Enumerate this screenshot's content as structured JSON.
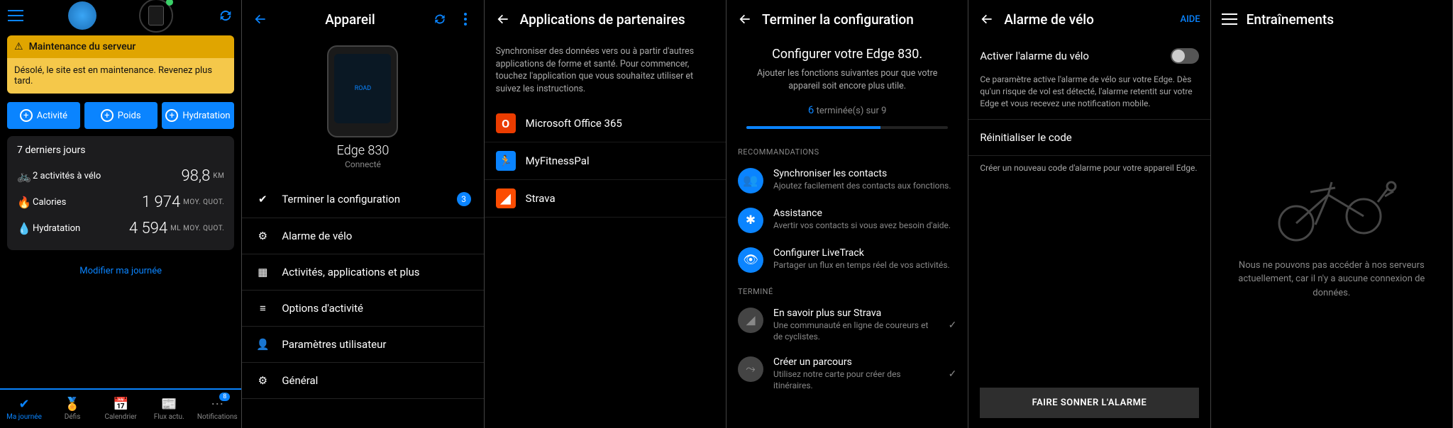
{
  "s1": {
    "maintenance_title": "Maintenance du serveur",
    "maintenance_body": "Désolé, le site est en maintenance. Revenez plus tard.",
    "quick": {
      "activity": "Activité",
      "weight": "Poids",
      "hydration": "Hydratation"
    },
    "card_title": "7 derniers jours",
    "stats": {
      "rides_label": "2 activités à vélo",
      "rides_val": "98,8",
      "rides_unit": "KM",
      "cal_label": "Calories",
      "cal_val": "1 974",
      "cal_unit": "MOY. QUOT.",
      "hyd_label": "Hydratation",
      "hyd_val": "4 594",
      "hyd_unit": "ML MOY. QUOT."
    },
    "edit_link": "Modifier ma journée",
    "nav": {
      "myday": "Ma journée",
      "challenges": "Défis",
      "calendar": "Calendrier",
      "newsfeed": "Flux actu.",
      "notifications": "Notifications",
      "badge": "8"
    }
  },
  "s2": {
    "title": "Appareil",
    "device_name": "Edge 830",
    "device_status": "Connecté",
    "items": {
      "finish": "Terminer la configuration",
      "finish_badge": "3",
      "alarm": "Alarme de vélo",
      "apps": "Activités, applications et plus",
      "options": "Options d'activité",
      "user": "Paramètres utilisateur",
      "general": "Général"
    }
  },
  "s3": {
    "title": "Applications de partenaires",
    "desc": "Synchroniser des données vers ou à partir d'autres applications de forme et santé. Pour commencer, touchez l'application que vous souhaitez utiliser et suivez les instructions.",
    "apps": {
      "o365": "Microsoft Office 365",
      "mfp": "MyFitnessPal",
      "strava": "Strava"
    }
  },
  "s4": {
    "title": "Terminer la configuration",
    "heading": "Configurer votre Edge 830.",
    "sub": "Ajouter les fonctions suivantes pour que votre appareil soit encore plus utile.",
    "count_num": "6",
    "count_rest": "terminée(s) sur 9",
    "sec_reco": "RECOMMANDATIONS",
    "reco1_t": "Synchroniser les contacts",
    "reco1_s": "Ajoutez facilement des contacts aux fonctions.",
    "reco2_t": "Assistance",
    "reco2_s": "Avertir vos contacts si vous avez besoin d'aide.",
    "reco3_t": "Configurer LiveTrack",
    "reco3_s": "Partager un flux en temps réel de vos activités.",
    "sec_done": "TERMINÉ",
    "done1_t": "En savoir plus sur Strava",
    "done1_s": "Une communauté en ligne de coureurs et de cyclistes.",
    "done2_t": "Créer un parcours",
    "done2_s": "Utilisez notre carte pour créer des itinéraires."
  },
  "s5": {
    "title": "Alarme de vélo",
    "help": "AIDE",
    "toggle_label": "Activer l'alarme du vélo",
    "toggle_desc": "Ce paramètre active l'alarme de vélo sur votre Edge. Dès qu'un risque de vol est détecté, l'alarme retentit sur votre Edge et vous recevez une notification mobile.",
    "reset": "Réinitialiser le code",
    "reset_desc": "Créer un nouveau code d'alarme pour votre appareil Edge.",
    "ring_btn": "FAIRE SONNER L'ALARME"
  },
  "s6": {
    "title": "Entraînements",
    "empty": "Nous ne pouvons pas accéder à nos serveurs actuellement, car il n'y a aucune connexion de données."
  }
}
